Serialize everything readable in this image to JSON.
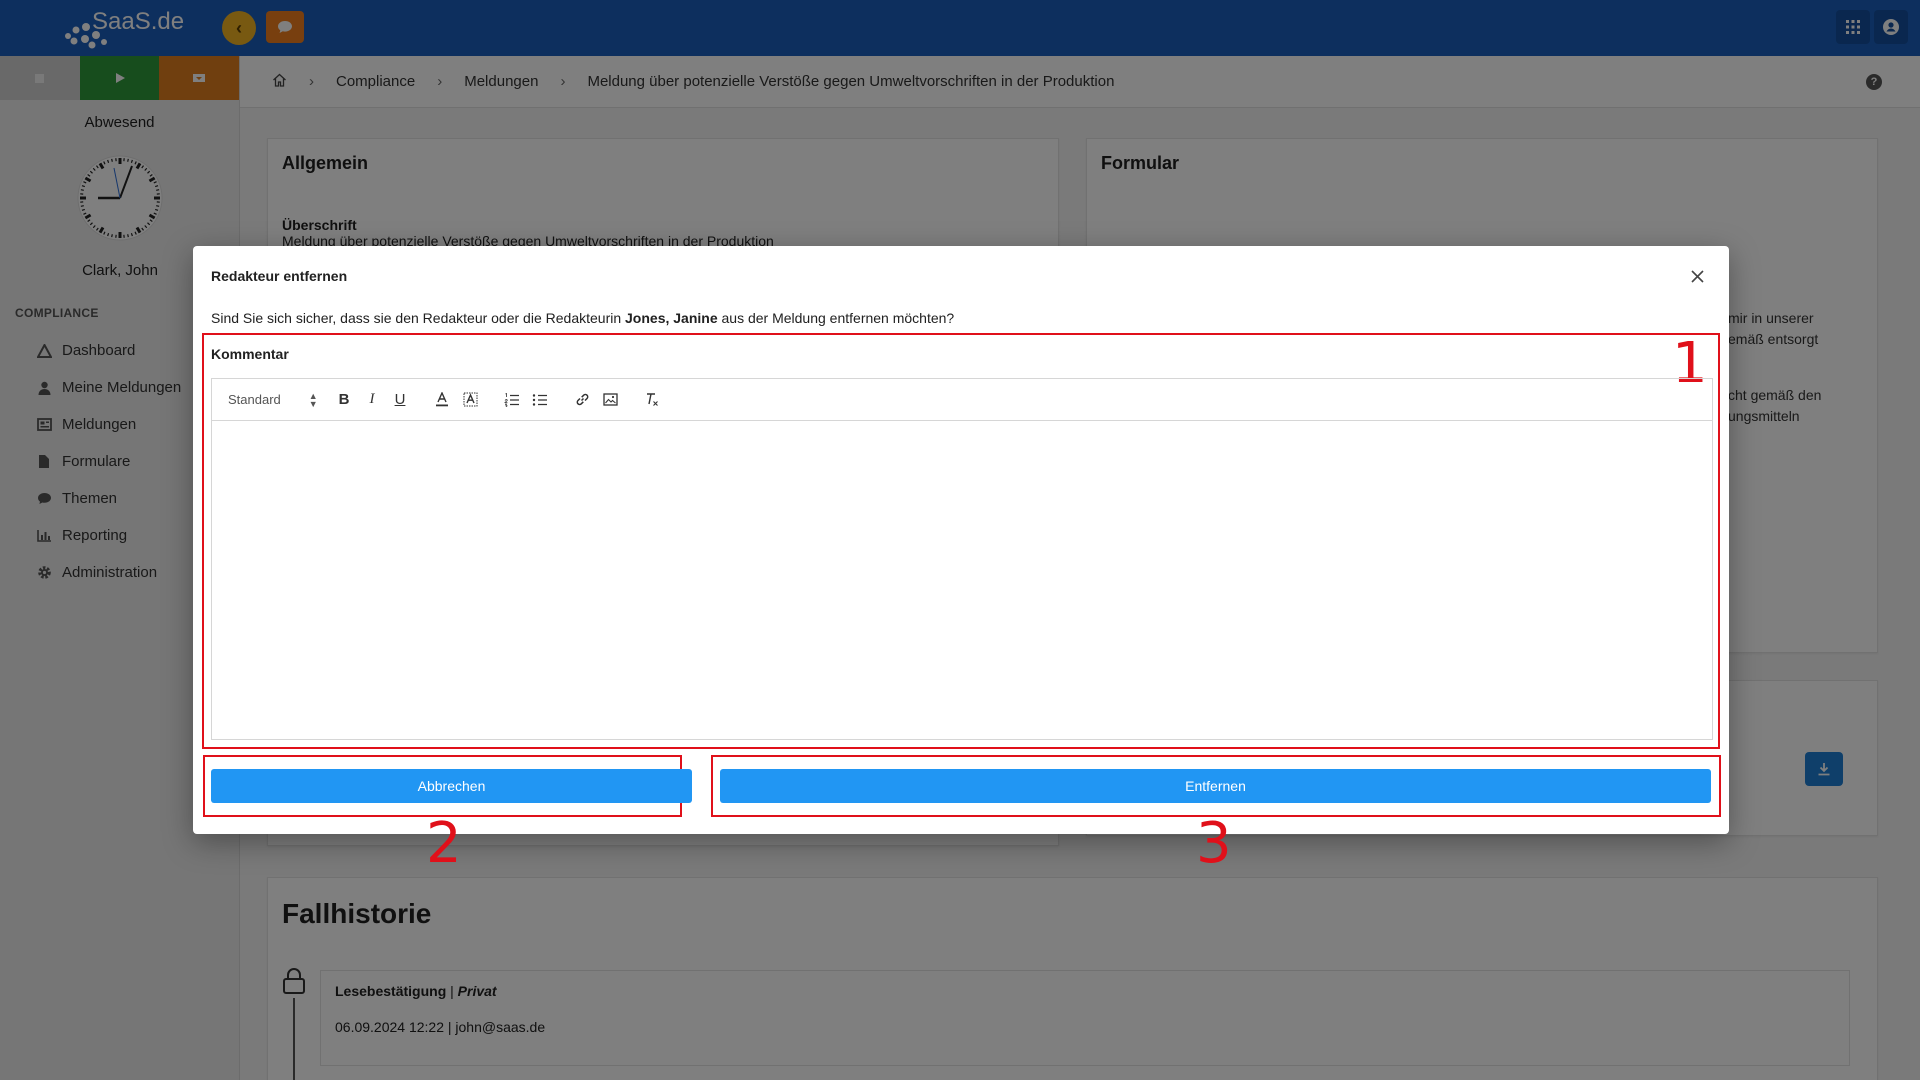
{
  "app": {
    "logo_text": "SaaS.de",
    "back_icon": "chevron-left-icon",
    "chat_icon": "chat-icon",
    "apps_icon": "grid-icon",
    "user_icon": "user-circle-icon",
    "header_color": "#1b5fbd"
  },
  "sidebar": {
    "status": "Abwesend",
    "user": "Clark, John",
    "section": "COMPLIANCE",
    "items": [
      {
        "label": "Dashboard",
        "icon": "dashboard-icon"
      },
      {
        "label": "Meine Meldungen",
        "icon": "user-icon"
      },
      {
        "label": "Meldungen",
        "icon": "newspaper-icon"
      },
      {
        "label": "Formulare",
        "icon": "file-icon"
      },
      {
        "label": "Themen",
        "icon": "comment-icon"
      },
      {
        "label": "Reporting",
        "icon": "bar-chart-icon"
      },
      {
        "label": "Administration",
        "icon": "gear-icon"
      }
    ]
  },
  "breadcrumb": {
    "items": [
      "Compliance",
      "Meldungen",
      "Meldung über potenzielle Verstöße gegen Umweltvorschriften in der Produktion"
    ]
  },
  "main": {
    "general": {
      "title": "Allgemein",
      "field_label": "Überschrift",
      "field_value": "Meldung über potenzielle Verstöße gegen Umweltvorschriften in der Produktion"
    },
    "form": {
      "title": "Formular",
      "partial_lines": [
        "mir in unserer",
        "emäß entsorgt",
        "cht gemäß den",
        "ungsmitteln"
      ]
    },
    "history": {
      "title": "Fallhistorie",
      "entry_type": "Lesebestätigung",
      "entry_sep": " | ",
      "entry_visibility": "Privat",
      "entry_meta": "06.09.2024 12:22 | john@saas.de"
    }
  },
  "modal": {
    "title": "Redakteur entfernen",
    "question_before": "Sind Sie sich sicher, dass sie den Redakteur oder die Redakteurin ",
    "question_name": "Jones, Janine",
    "question_after": " aus der Meldung entfernen möchten?",
    "comment_label": "Kommentar",
    "toolbar": {
      "style_select": "Standard",
      "buttons": [
        "B",
        "I",
        "U"
      ]
    },
    "cancel_label": "Abbrechen",
    "remove_label": "Entfernen",
    "annotations": [
      "1",
      "2",
      "3"
    ],
    "button_color": "#2196f3",
    "annotation_color": "#e0101a"
  }
}
